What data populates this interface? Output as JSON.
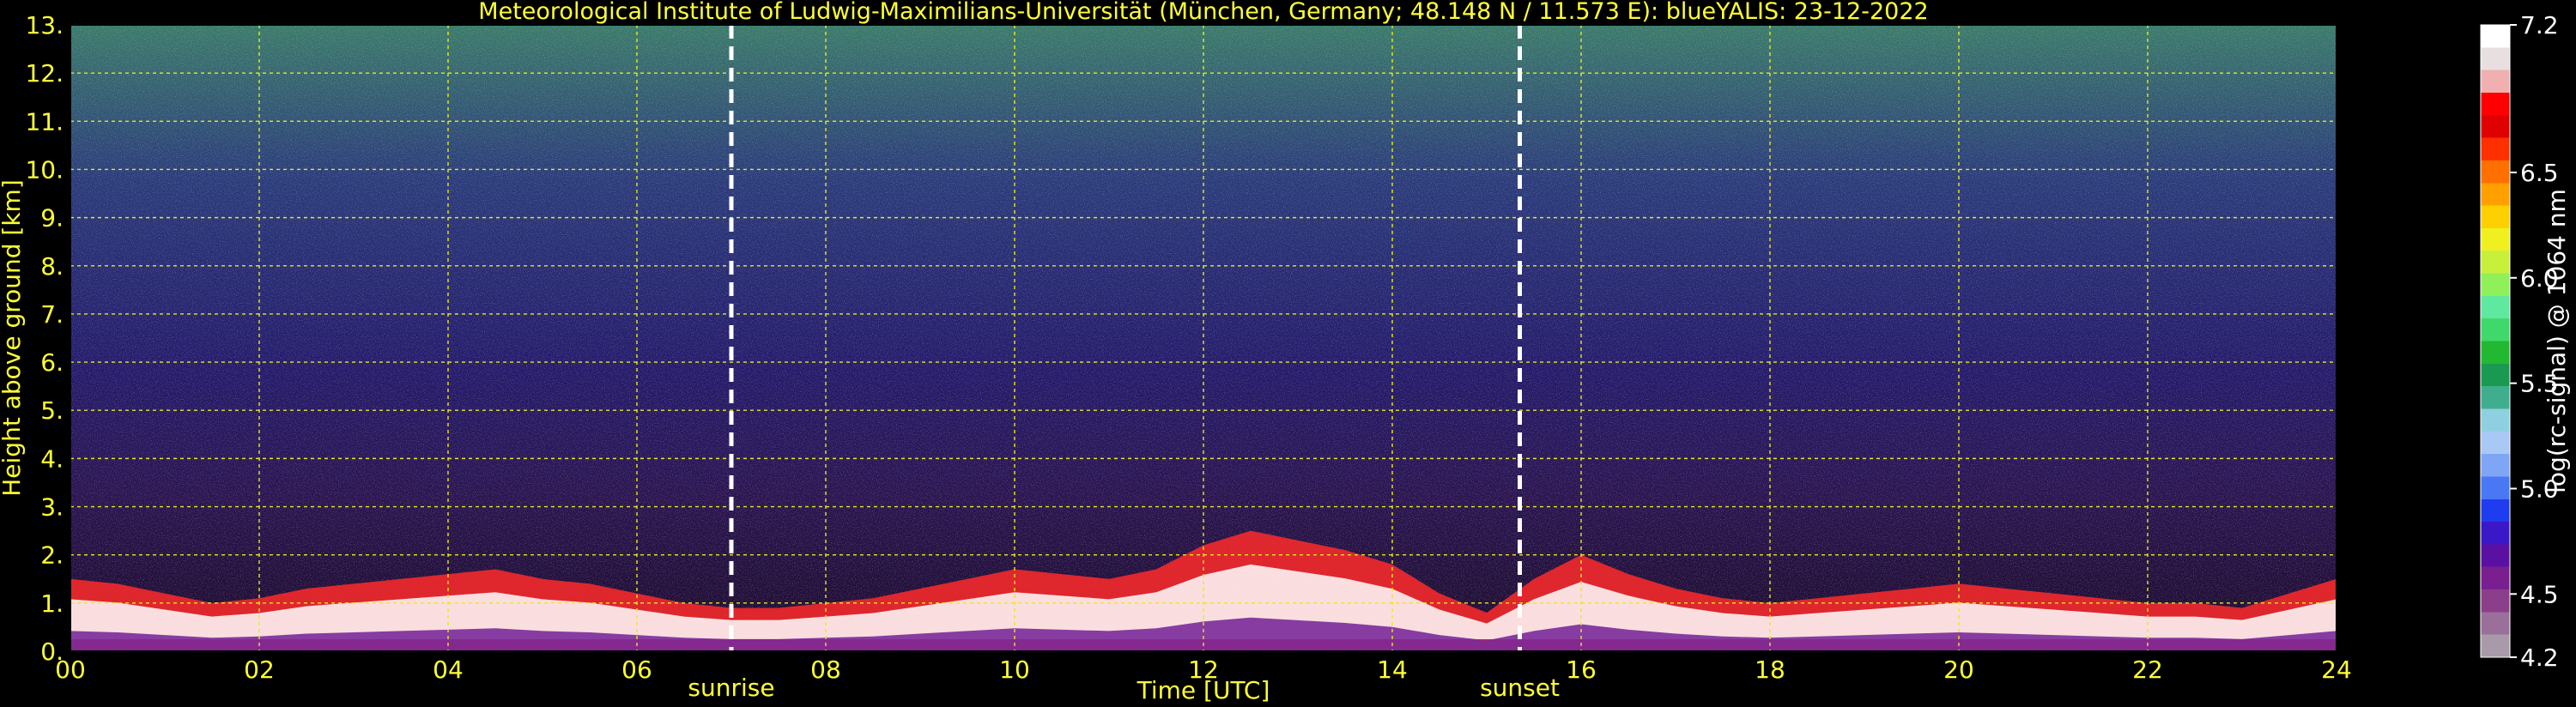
{
  "chart_data": {
    "type": "heatmap",
    "title": "Meteorological Institute of Ludwig-Maximilians-Universität (München, Germany; 48.148 N / 11.573 E):    blueYALIS: 23-12-2022",
    "xlabel": "Time [UTC]",
    "ylabel": "Height above ground [km]",
    "xlim": [
      0,
      24
    ],
    "ylim": [
      0,
      13
    ],
    "x_ticks": [
      "00",
      "02",
      "04",
      "06",
      "08",
      "10",
      "12",
      "14",
      "16",
      "18",
      "20",
      "22",
      "24"
    ],
    "y_ticks": [
      "0.",
      "1.",
      "2.",
      "3.",
      "4.",
      "5.",
      "6.",
      "7.",
      "8.",
      "9.",
      "10.",
      "11.",
      "12.",
      "13."
    ],
    "grid": true,
    "annotations": [
      {
        "label": "sunrise",
        "x": 7.0
      },
      {
        "label": "sunset",
        "x": 15.35
      }
    ],
    "colorbar": {
      "label": "log(rc-signal) @ 1064 nm",
      "range": [
        4.2,
        7.2
      ],
      "ticks": [
        "7.2",
        "6.5",
        "6.0",
        "5.5",
        "5.0",
        "4.5",
        "4.2"
      ],
      "tick_values": [
        7.2,
        6.5,
        6.0,
        5.5,
        5.0,
        4.5,
        4.2
      ],
      "colors_bottom_to_top": [
        "#a89aa8",
        "#9a6f9a",
        "#8b3f8b",
        "#7a1f8f",
        "#5a10a0",
        "#3a18c8",
        "#1f3cf0",
        "#4a78f5",
        "#7fa6f5",
        "#a8c8f5",
        "#8fd0e0",
        "#3fae8f",
        "#1a9a50",
        "#22b832",
        "#3fd86a",
        "#5fe8a0",
        "#8ff05a",
        "#c8f03a",
        "#f0f020",
        "#ffd000",
        "#ffa000",
        "#ff7000",
        "#ff3000",
        "#e00000",
        "#ff0000",
        "#f0b0b0",
        "#e8e0e0",
        "#ffffff"
      ]
    },
    "series": [
      {
        "x": [
          0.0,
          0.5,
          1.0,
          1.5,
          2.0,
          2.5,
          3.0,
          3.5,
          4.0,
          4.5,
          5.0,
          5.5,
          6.0,
          6.5,
          7.0,
          7.5,
          8.0,
          8.5,
          9.0,
          9.5,
          10.0,
          10.5,
          11.0,
          11.5,
          12.0,
          12.5,
          13.0,
          13.5,
          14.0,
          14.5,
          15.0,
          15.5,
          16.0,
          16.5,
          17.0,
          17.5,
          18.0,
          18.5,
          19.0,
          19.5,
          20.0,
          20.5,
          21.0,
          21.5,
          22.0,
          22.5,
          23.0,
          23.5,
          24.0
        ],
        "y": [
          1.5,
          1.4,
          1.2,
          1.0,
          1.1,
          1.3,
          1.4,
          1.5,
          1.6,
          1.7,
          1.5,
          1.4,
          1.2,
          1.0,
          0.9,
          0.9,
          1.0,
          1.1,
          1.3,
          1.5,
          1.7,
          1.6,
          1.5,
          1.7,
          2.2,
          2.5,
          2.3,
          2.1,
          1.8,
          1.2,
          0.8,
          1.5,
          2.0,
          1.6,
          1.3,
          1.1,
          1.0,
          1.1,
          1.2,
          1.3,
          1.4,
          1.3,
          1.2,
          1.1,
          1.0,
          1.0,
          0.9,
          1.2,
          1.5
        ]
      }
    ]
  }
}
